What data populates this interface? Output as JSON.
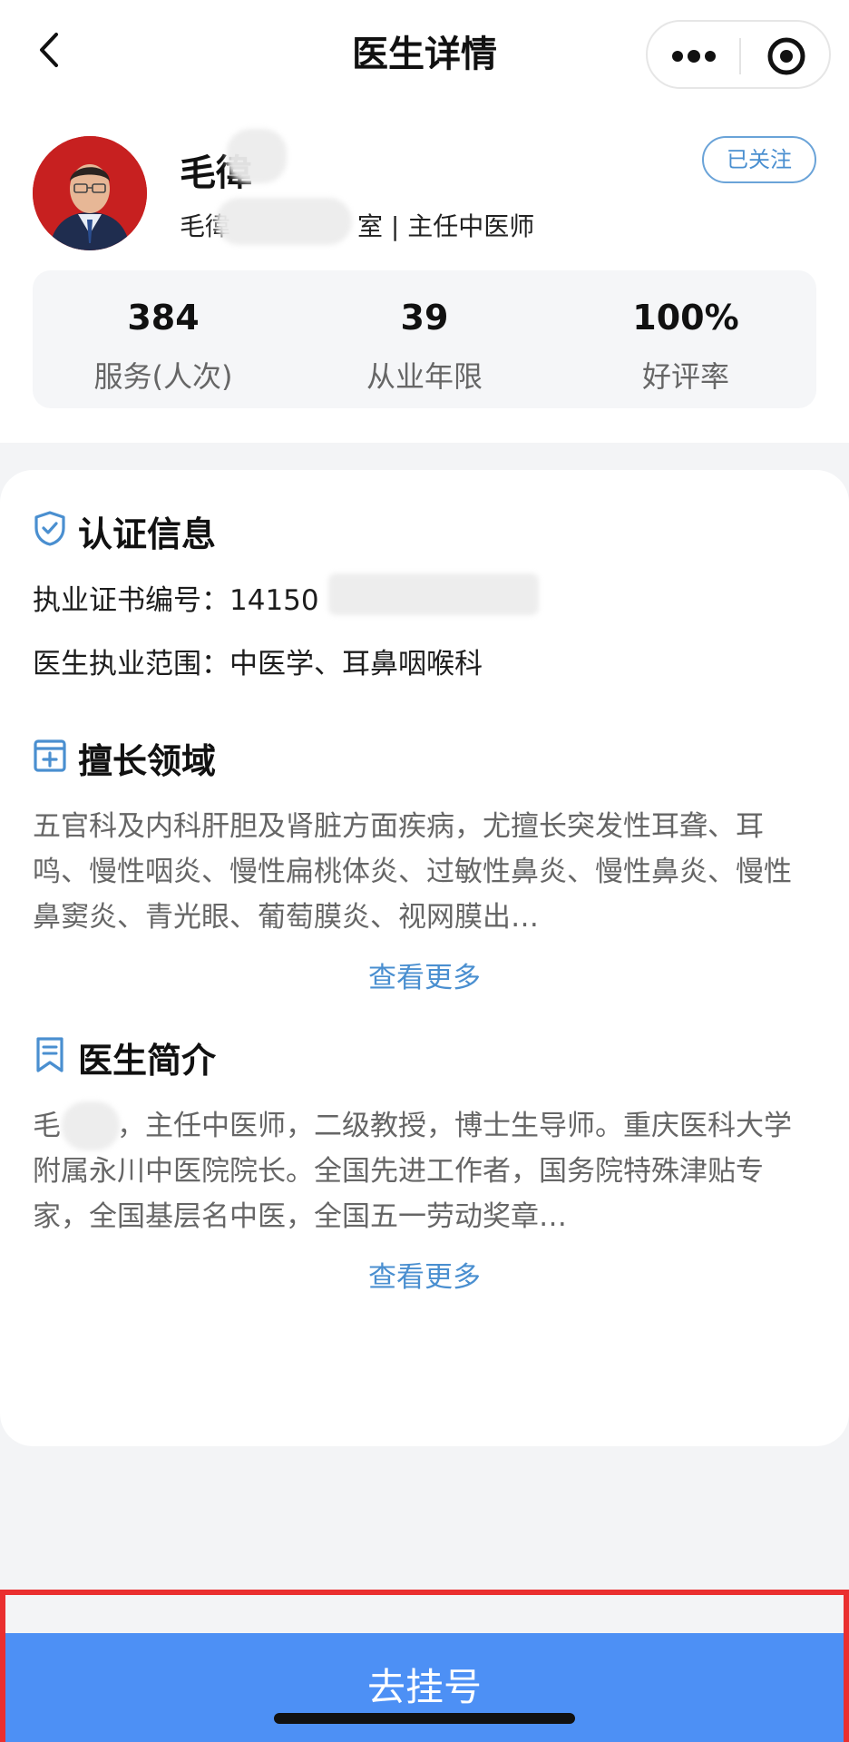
{
  "nav": {
    "title": "医生详情"
  },
  "doctor": {
    "name": "毛徫",
    "department_prefix": "毛徫",
    "department_suffix": "室 | 主任中医师",
    "follow_label": "已关注"
  },
  "stats": [
    {
      "value": "384",
      "label": "服务(人次)"
    },
    {
      "value": "39",
      "label": "从业年限"
    },
    {
      "value": "100%",
      "label": "好评率"
    }
  ],
  "certification": {
    "title": "认证信息",
    "license_label": "执业证书编号：",
    "license_value": "14150",
    "scope_label": "医生执业范围：",
    "scope_value": "中医学、耳鼻咽喉科"
  },
  "expertise": {
    "title": "擅长领域",
    "text": "五官科及内科肝胆及肾脏方面疾病，尤擅长突发性耳聋、耳鸣、慢性咽炎、慢性扁桃体炎、过敏性鼻炎、慢性鼻炎、慢性鼻窦炎、青光眼、葡萄膜炎、视网膜出…",
    "more_label": "查看更多"
  },
  "intro": {
    "title": "医生简介",
    "text": "毛　　，主任中医师，二级教授，博士生导师。重庆医科大学附属永川中医院院长。全国先进工作者，国务院特殊津贴专家，全国基层名中医，全国五一劳动奖章…",
    "more_label": "查看更多"
  },
  "action": {
    "book_label": "去挂号"
  },
  "colors": {
    "accent": "#4d90f5",
    "link": "#4a8fd0",
    "highlight_border": "#ea2f2f"
  }
}
